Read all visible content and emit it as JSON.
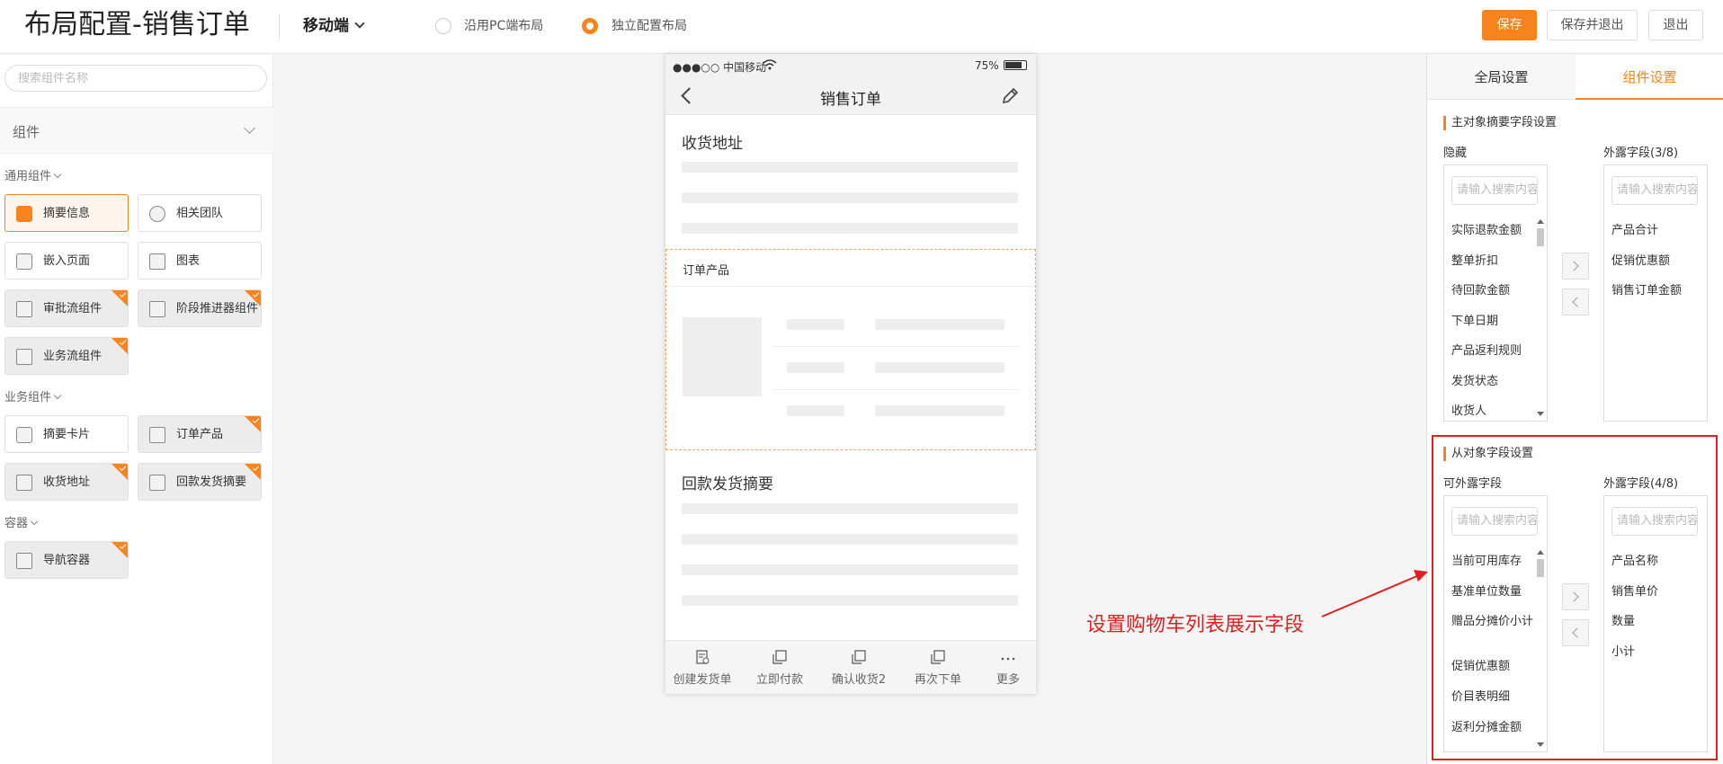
{
  "header": {
    "title": "布局配置-销售订单",
    "mode": "移动端",
    "options": [
      {
        "label": "沿用PC端布局",
        "selected": false
      },
      {
        "label": "独立配置布局",
        "selected": true
      }
    ],
    "buttons": {
      "save": "保存",
      "save_exit": "保存并退出",
      "exit": "退出"
    },
    "accent": "#f7841c"
  },
  "left": {
    "search_placeholder": "搜索组件名称",
    "group_title": "组件",
    "sections": [
      {
        "label": "通用组件",
        "items": [
          {
            "label": "摘要信息",
            "selected": true,
            "badge": false
          },
          {
            "label": "相关团队",
            "selected": false,
            "badge": false
          },
          {
            "label": "嵌入页面",
            "selected": false,
            "badge": false
          },
          {
            "label": "图表",
            "selected": false,
            "badge": false
          },
          {
            "label": "审批流组件",
            "selected": false,
            "badge": true
          },
          {
            "label": "阶段推进器组件",
            "selected": false,
            "badge": true
          },
          {
            "label": "业务流组件",
            "selected": false,
            "badge": true
          }
        ]
      },
      {
        "label": "业务组件",
        "items": [
          {
            "label": "摘要卡片",
            "selected": false,
            "badge": false
          },
          {
            "label": "订单产品",
            "selected": false,
            "badge": true
          },
          {
            "label": "收货地址",
            "selected": false,
            "badge": true
          },
          {
            "label": "回款发货摘要",
            "selected": false,
            "badge": true
          }
        ]
      },
      {
        "label": "容器",
        "items": [
          {
            "label": "导航容器",
            "selected": false,
            "badge": true
          }
        ]
      }
    ]
  },
  "phone": {
    "carrier": "●●●○○ 中国移动",
    "battery": "75%",
    "nav_title": "销售订单",
    "sections": {
      "address": "收货地址",
      "products": "订单产品",
      "payment": "回款发货摘要"
    },
    "tabs": [
      "创建发货单",
      "立即付款",
      "确认收货2",
      "再次下单",
      "更多"
    ]
  },
  "right": {
    "tabs": [
      {
        "label": "全局设置",
        "active": false
      },
      {
        "label": "组件设置",
        "active": true
      }
    ],
    "main": {
      "title": "主对象摘要字段设置",
      "left_header": "隐藏",
      "right_header": "外露字段(3/8)",
      "search_placeholder": "请输入搜索内容",
      "left_items": [
        "实际退款金额",
        "整单折扣",
        "待回款金额",
        "下单日期",
        "产品返利规则",
        "发货状态",
        "收货人"
      ],
      "right_items": [
        "产品合计",
        "促销优惠额",
        "销售订单金额"
      ]
    },
    "sub": {
      "title": "从对象字段设置",
      "left_header": "可外露字段",
      "right_header": "外露字段(4/8)",
      "search_placeholder": "请输入搜索内容",
      "left_items": [
        "当前可用库存",
        "基准单位数量",
        "赠品分摊价小计",
        "促销优惠额",
        "价目表明细",
        "返利分摊金额"
      ],
      "right_items": [
        "产品名称",
        "销售单价",
        "数量",
        "小计"
      ]
    }
  },
  "annotation": {
    "text": "设置购物车列表展示字段",
    "color": "#e02020"
  }
}
